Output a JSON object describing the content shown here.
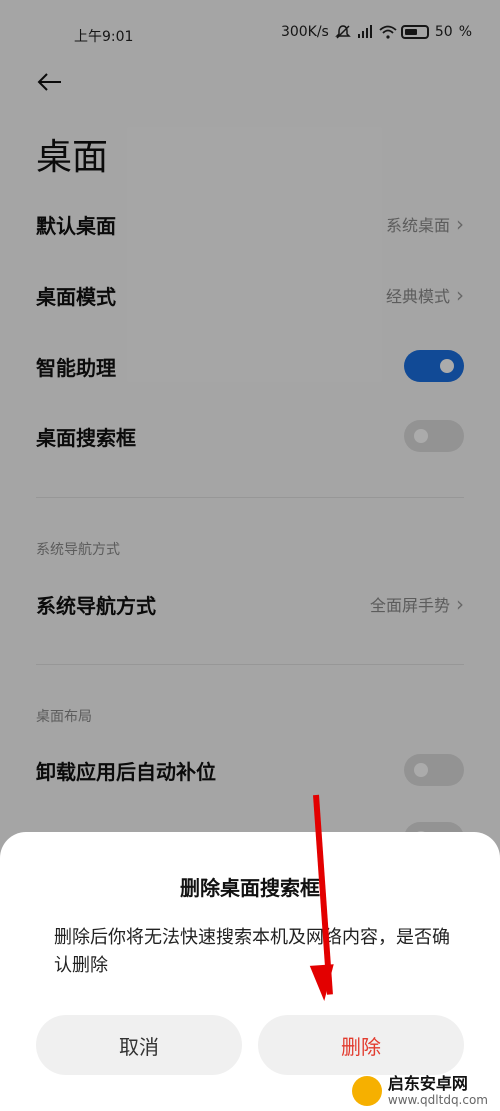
{
  "status_bar": {
    "time": "上午9:01",
    "speed": "300K/s",
    "battery": "50"
  },
  "header": {
    "title": "桌面"
  },
  "settings": {
    "default_desktop": {
      "label": "默认桌面",
      "value": "系统桌面"
    },
    "desktop_mode": {
      "label": "桌面模式",
      "value": "经典模式"
    },
    "smart_assistant": {
      "label": "智能助理",
      "enabled": true
    },
    "desktop_search": {
      "label": "桌面搜索框",
      "enabled": false
    },
    "nav_section": "系统导航方式",
    "nav_method": {
      "label": "系统导航方式",
      "value": "全面屏手势"
    },
    "layout_section": "桌面布局",
    "auto_fill": {
      "label": "卸载应用后自动补位",
      "enabled": false
    }
  },
  "dialog": {
    "title": "删除桌面搜索框",
    "message": "删除后你将无法快速搜索本机及网络内容，是否确认删除",
    "cancel": "取消",
    "delete": "删除"
  },
  "watermark": {
    "name": "启东安卓网",
    "url": "www.qdltdq.com"
  },
  "colors": {
    "accent": "#1a6fe0",
    "danger": "#e23b2e",
    "annotation": "#e30000"
  }
}
